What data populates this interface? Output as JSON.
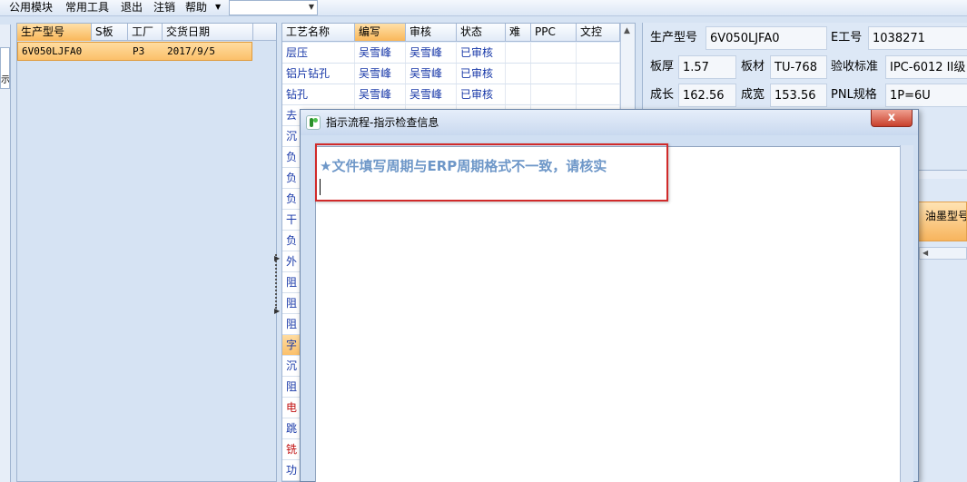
{
  "menubar": {
    "items": [
      "公用模块",
      "常用工具",
      "退出",
      "注销",
      "帮助"
    ]
  },
  "left_strip": {
    "tab_label": "示"
  },
  "order_grid": {
    "columns": [
      "生产型号",
      "S板",
      "工厂",
      "交货日期"
    ],
    "rows": [
      {
        "model": "6V050LJFA0",
        "s_board": "",
        "factory": "P3",
        "delivery_date": "2017/9/5"
      }
    ]
  },
  "process_grid": {
    "columns": [
      "工艺名称",
      "编写",
      "审核",
      "状态",
      "难",
      "PPC",
      "文控"
    ],
    "rows": [
      {
        "name": "层压",
        "writer": "吴雪峰",
        "reviewer": "吴雪峰",
        "status": "已审核"
      },
      {
        "name": "铝片钻孔",
        "writer": "吴雪峰",
        "reviewer": "吴雪峰",
        "status": "已审核"
      },
      {
        "name": "钻孔",
        "writer": "吴雪峰",
        "reviewer": "吴雪峰",
        "status": "已审核"
      },
      {
        "name": "去",
        "writer": "",
        "reviewer": "",
        "status": ""
      },
      {
        "name": "沉",
        "writer": "",
        "reviewer": "",
        "status": ""
      },
      {
        "name": "负",
        "writer": "",
        "reviewer": "",
        "status": ""
      },
      {
        "name": "负",
        "writer": "",
        "reviewer": "",
        "status": ""
      },
      {
        "name": "负",
        "writer": "",
        "reviewer": "",
        "status": ""
      },
      {
        "name": "干",
        "writer": "",
        "reviewer": "",
        "status": ""
      },
      {
        "name": "负",
        "writer": "",
        "reviewer": "",
        "status": ""
      },
      {
        "name": "外",
        "writer": "",
        "reviewer": "",
        "status": ""
      },
      {
        "name": "阻",
        "writer": "",
        "reviewer": "",
        "status": ""
      },
      {
        "name": "阻",
        "writer": "",
        "reviewer": "",
        "status": ""
      },
      {
        "name": "阻",
        "writer": "",
        "reviewer": "",
        "status": ""
      },
      {
        "name": "字",
        "writer": "",
        "reviewer": "",
        "status": ""
      },
      {
        "name": "沉",
        "writer": "",
        "reviewer": "",
        "status": ""
      },
      {
        "name": "阻",
        "writer": "",
        "reviewer": "",
        "status": ""
      },
      {
        "name": "电",
        "writer": "",
        "reviewer": "",
        "status": ""
      },
      {
        "name": "跳",
        "writer": "",
        "reviewer": "",
        "status": ""
      },
      {
        "name": "铣",
        "writer": "",
        "reviewer": "",
        "status": ""
      },
      {
        "name": "功",
        "writer": "",
        "reviewer": "",
        "status": ""
      }
    ]
  },
  "info": {
    "model_label": "生产型号",
    "model_value": "6V050LJFA0",
    "e_no_label": "E工号",
    "e_no_value": "1038271",
    "thickness_label": "板厚",
    "thickness_value": "1.57",
    "material_label": "板材",
    "material_value": "TU-768",
    "standard_label": "验收标准",
    "standard_value": "IPC-6012 II级",
    "length_label": "成长",
    "length_value": "162.56",
    "width_label": "成宽",
    "width_value": "153.56",
    "pnl_label": "PNL规格",
    "pnl_value": "1P=6U"
  },
  "ink_grid": {
    "header": "油墨型号"
  },
  "dialog": {
    "title": "指示流程-指示检查信息",
    "close_label": "x",
    "message": "★文件填写周期与ERP周期格式不一致，请核实"
  },
  "colors": {
    "accent_orange": "#fbc06a",
    "message_blue": "#6e97c8",
    "highlight_red": "#d12a2a",
    "grid_text_blue": "#1838a8"
  }
}
